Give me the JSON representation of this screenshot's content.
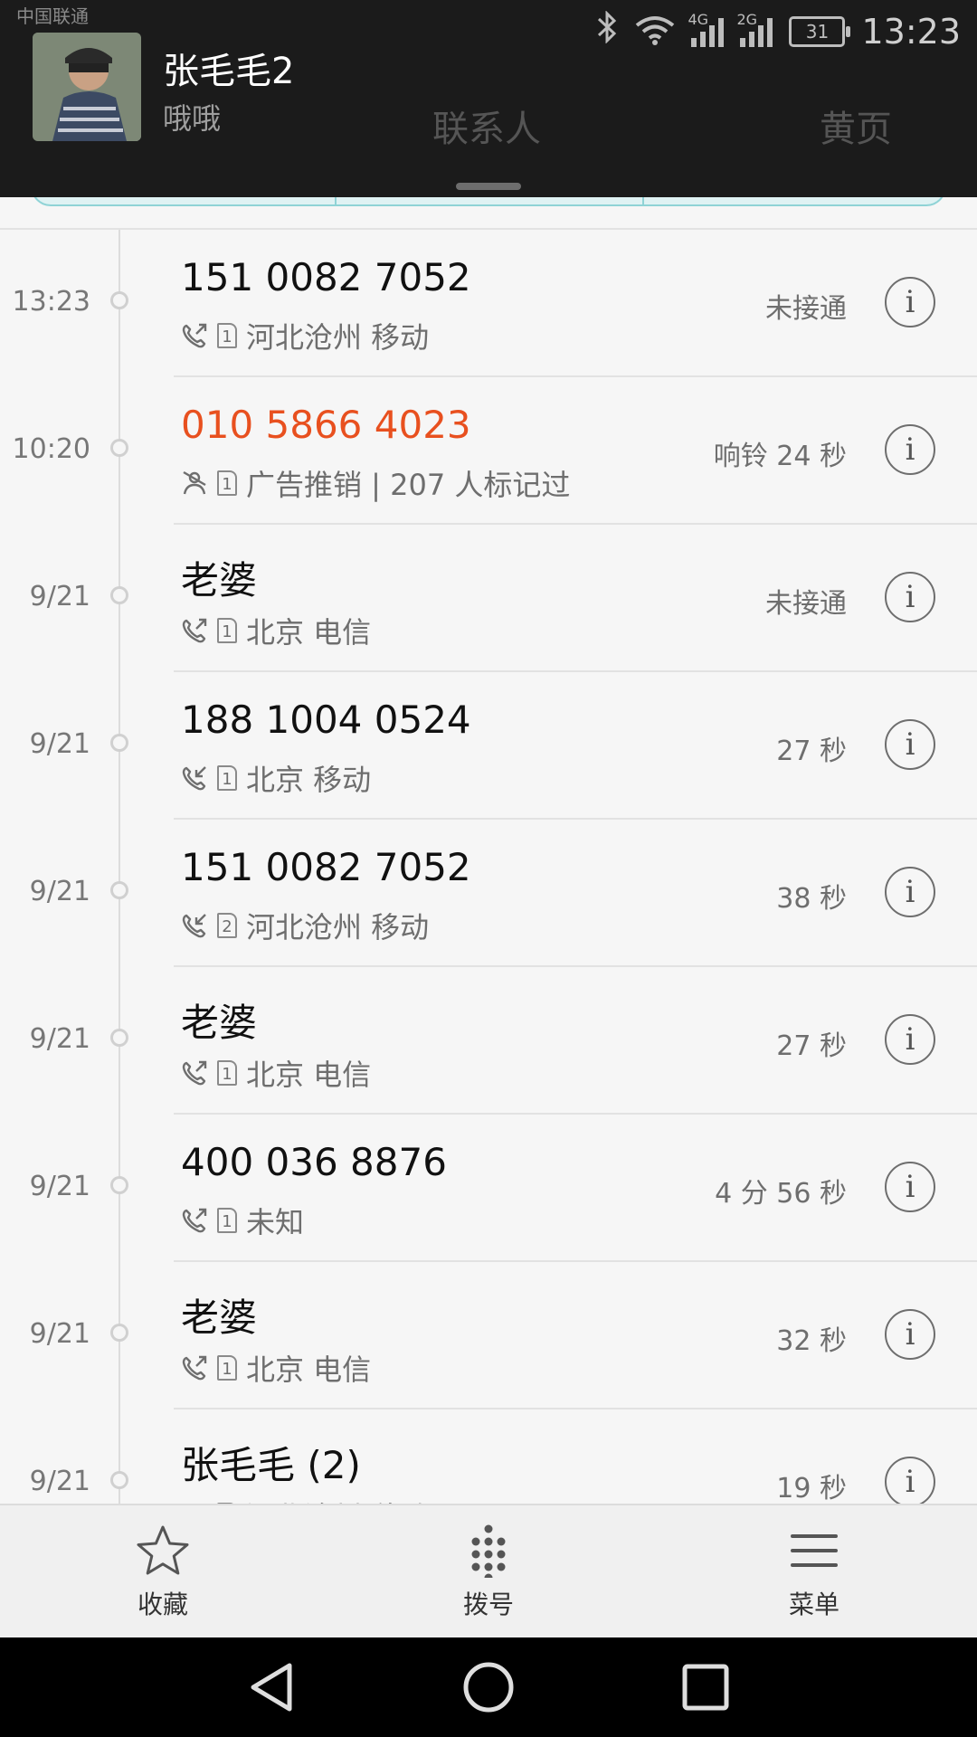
{
  "status_bar": {
    "carrier": "中国联通",
    "time": "13:23",
    "battery": "31",
    "net_a": "4G",
    "net_b": "2G"
  },
  "notification": {
    "title": "张毛毛2",
    "subtitle": "哦哦"
  },
  "tabs_behind": [
    "联系人",
    "黄页"
  ],
  "calls": [
    {
      "time": "13:23",
      "name": "151 0082 7052",
      "sim": "1",
      "location": "河北沧州 移动",
      "duration": "未接通",
      "type": "outgoing",
      "spam": false
    },
    {
      "time": "10:20",
      "name": "010 5866 4023",
      "sim": "1",
      "location": "广告推销 | 207 人标记过",
      "duration": "响铃 24 秒",
      "type": "missed",
      "spam": true
    },
    {
      "time": "9/21",
      "name": "老婆",
      "sim": "1",
      "location": "北京 电信",
      "duration": "未接通",
      "type": "outgoing",
      "spam": false
    },
    {
      "time": "9/21",
      "name": "188 1004 0524",
      "sim": "1",
      "location": "北京 移动",
      "duration": "27 秒",
      "type": "incoming",
      "spam": false
    },
    {
      "time": "9/21",
      "name": "151 0082 7052",
      "sim": "2",
      "location": "河北沧州 移动",
      "duration": "38 秒",
      "type": "incoming",
      "spam": false
    },
    {
      "time": "9/21",
      "name": "老婆",
      "sim": "1",
      "location": "北京 电信",
      "duration": "27 秒",
      "type": "outgoing",
      "spam": false
    },
    {
      "time": "9/21",
      "name": "400 036 8876",
      "sim": "1",
      "location": "未知",
      "duration": "4 分 56 秒",
      "type": "outgoing",
      "spam": false
    },
    {
      "time": "9/21",
      "name": "老婆",
      "sim": "1",
      "location": "北京 电信",
      "duration": "32 秒",
      "type": "outgoing",
      "spam": false
    },
    {
      "time": "9/21",
      "name": "张毛毛 (2)",
      "sim": "1",
      "location": "河北沧州 移动",
      "duration": "19 秒",
      "type": "incoming",
      "spam": false
    }
  ],
  "bottom_bar": {
    "favorites_label": "收藏",
    "dial_label": "拨号",
    "menu_label": "菜单"
  },
  "colors": {
    "spam_number": "#e8501f",
    "accent_strip": "#8fd3d6"
  }
}
